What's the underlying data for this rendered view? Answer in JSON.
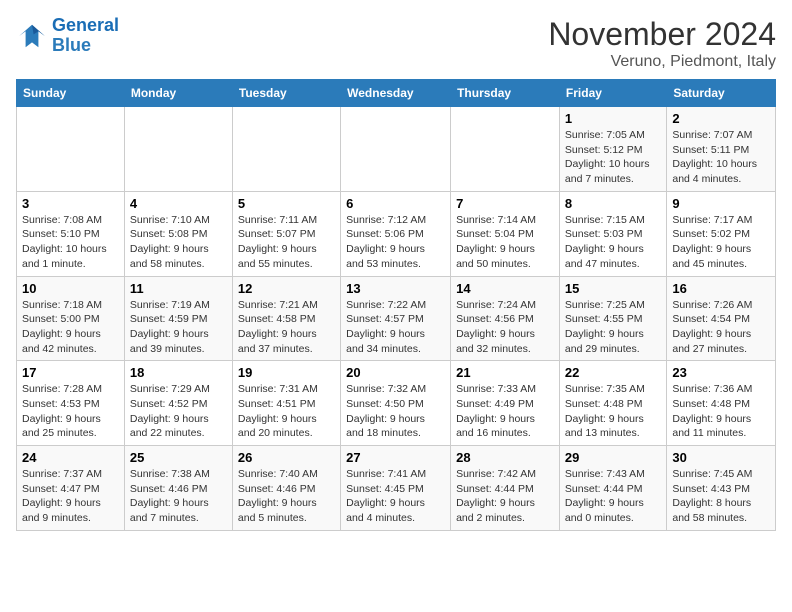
{
  "header": {
    "logo_line1": "General",
    "logo_line2": "Blue",
    "month": "November 2024",
    "location": "Veruno, Piedmont, Italy"
  },
  "weekdays": [
    "Sunday",
    "Monday",
    "Tuesday",
    "Wednesday",
    "Thursday",
    "Friday",
    "Saturday"
  ],
  "weeks": [
    [
      {
        "day": "",
        "info": ""
      },
      {
        "day": "",
        "info": ""
      },
      {
        "day": "",
        "info": ""
      },
      {
        "day": "",
        "info": ""
      },
      {
        "day": "",
        "info": ""
      },
      {
        "day": "1",
        "info": "Sunrise: 7:05 AM\nSunset: 5:12 PM\nDaylight: 10 hours and 7 minutes."
      },
      {
        "day": "2",
        "info": "Sunrise: 7:07 AM\nSunset: 5:11 PM\nDaylight: 10 hours and 4 minutes."
      }
    ],
    [
      {
        "day": "3",
        "info": "Sunrise: 7:08 AM\nSunset: 5:10 PM\nDaylight: 10 hours and 1 minute."
      },
      {
        "day": "4",
        "info": "Sunrise: 7:10 AM\nSunset: 5:08 PM\nDaylight: 9 hours and 58 minutes."
      },
      {
        "day": "5",
        "info": "Sunrise: 7:11 AM\nSunset: 5:07 PM\nDaylight: 9 hours and 55 minutes."
      },
      {
        "day": "6",
        "info": "Sunrise: 7:12 AM\nSunset: 5:06 PM\nDaylight: 9 hours and 53 minutes."
      },
      {
        "day": "7",
        "info": "Sunrise: 7:14 AM\nSunset: 5:04 PM\nDaylight: 9 hours and 50 minutes."
      },
      {
        "day": "8",
        "info": "Sunrise: 7:15 AM\nSunset: 5:03 PM\nDaylight: 9 hours and 47 minutes."
      },
      {
        "day": "9",
        "info": "Sunrise: 7:17 AM\nSunset: 5:02 PM\nDaylight: 9 hours and 45 minutes."
      }
    ],
    [
      {
        "day": "10",
        "info": "Sunrise: 7:18 AM\nSunset: 5:00 PM\nDaylight: 9 hours and 42 minutes."
      },
      {
        "day": "11",
        "info": "Sunrise: 7:19 AM\nSunset: 4:59 PM\nDaylight: 9 hours and 39 minutes."
      },
      {
        "day": "12",
        "info": "Sunrise: 7:21 AM\nSunset: 4:58 PM\nDaylight: 9 hours and 37 minutes."
      },
      {
        "day": "13",
        "info": "Sunrise: 7:22 AM\nSunset: 4:57 PM\nDaylight: 9 hours and 34 minutes."
      },
      {
        "day": "14",
        "info": "Sunrise: 7:24 AM\nSunset: 4:56 PM\nDaylight: 9 hours and 32 minutes."
      },
      {
        "day": "15",
        "info": "Sunrise: 7:25 AM\nSunset: 4:55 PM\nDaylight: 9 hours and 29 minutes."
      },
      {
        "day": "16",
        "info": "Sunrise: 7:26 AM\nSunset: 4:54 PM\nDaylight: 9 hours and 27 minutes."
      }
    ],
    [
      {
        "day": "17",
        "info": "Sunrise: 7:28 AM\nSunset: 4:53 PM\nDaylight: 9 hours and 25 minutes."
      },
      {
        "day": "18",
        "info": "Sunrise: 7:29 AM\nSunset: 4:52 PM\nDaylight: 9 hours and 22 minutes."
      },
      {
        "day": "19",
        "info": "Sunrise: 7:31 AM\nSunset: 4:51 PM\nDaylight: 9 hours and 20 minutes."
      },
      {
        "day": "20",
        "info": "Sunrise: 7:32 AM\nSunset: 4:50 PM\nDaylight: 9 hours and 18 minutes."
      },
      {
        "day": "21",
        "info": "Sunrise: 7:33 AM\nSunset: 4:49 PM\nDaylight: 9 hours and 16 minutes."
      },
      {
        "day": "22",
        "info": "Sunrise: 7:35 AM\nSunset: 4:48 PM\nDaylight: 9 hours and 13 minutes."
      },
      {
        "day": "23",
        "info": "Sunrise: 7:36 AM\nSunset: 4:48 PM\nDaylight: 9 hours and 11 minutes."
      }
    ],
    [
      {
        "day": "24",
        "info": "Sunrise: 7:37 AM\nSunset: 4:47 PM\nDaylight: 9 hours and 9 minutes."
      },
      {
        "day": "25",
        "info": "Sunrise: 7:38 AM\nSunset: 4:46 PM\nDaylight: 9 hours and 7 minutes."
      },
      {
        "day": "26",
        "info": "Sunrise: 7:40 AM\nSunset: 4:46 PM\nDaylight: 9 hours and 5 minutes."
      },
      {
        "day": "27",
        "info": "Sunrise: 7:41 AM\nSunset: 4:45 PM\nDaylight: 9 hours and 4 minutes."
      },
      {
        "day": "28",
        "info": "Sunrise: 7:42 AM\nSunset: 4:44 PM\nDaylight: 9 hours and 2 minutes."
      },
      {
        "day": "29",
        "info": "Sunrise: 7:43 AM\nSunset: 4:44 PM\nDaylight: 9 hours and 0 minutes."
      },
      {
        "day": "30",
        "info": "Sunrise: 7:45 AM\nSunset: 4:43 PM\nDaylight: 8 hours and 58 minutes."
      }
    ]
  ]
}
